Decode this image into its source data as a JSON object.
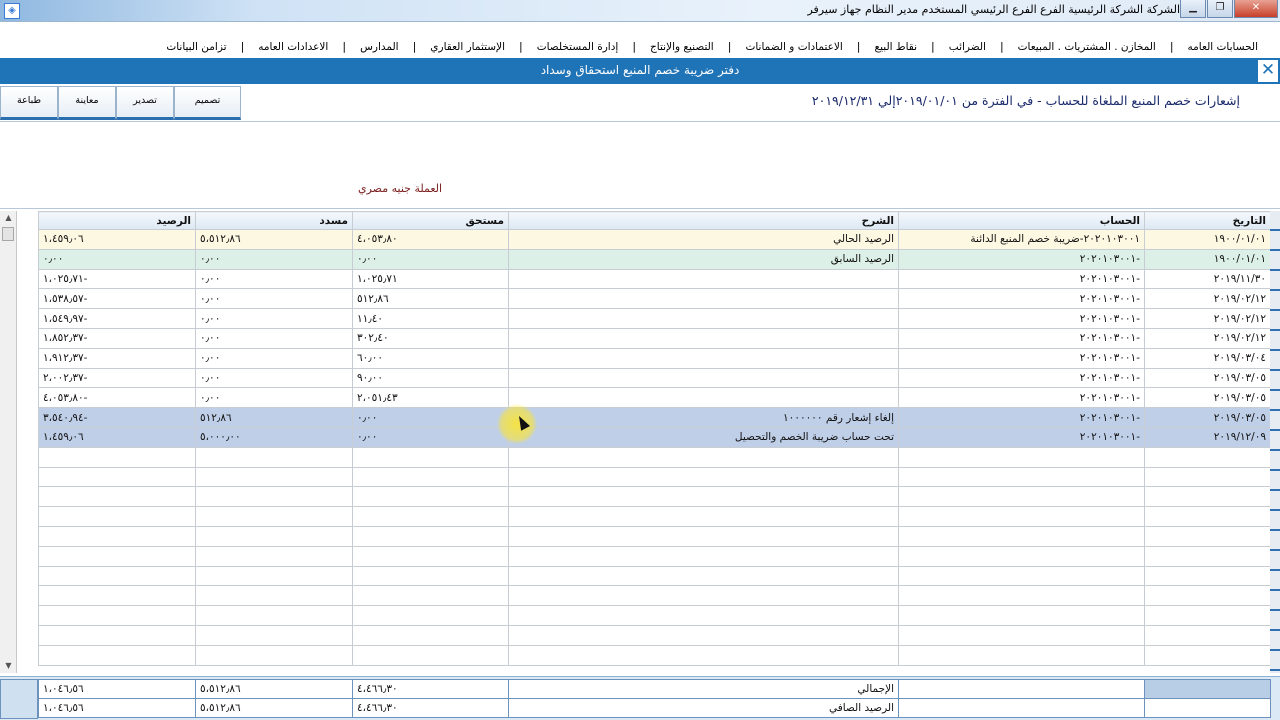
{
  "window": {
    "title": "الشركة الشركة الرئيسية    الفرع الفرع الرئيسي    المستخدم مدير النظام    جهاز سيرفر",
    "minimize": "▁",
    "restore": "❐",
    "close": "✕"
  },
  "menu": [
    "الحسابات العامه",
    "المخازن . المشتريات . المبيعات",
    "الضرائب",
    "نقاط البيع",
    "الاعتمادات و الضمانات",
    "التصنيع والإنتاج",
    "إدارة المستخلصات",
    "الإستثمار العقاري",
    "المدارس",
    "الاعدادات العامه",
    "تزامن البيانات"
  ],
  "banner": {
    "title": "دفتر ضريبة خصم المنبع استحقاق وسداد",
    "close": "✕"
  },
  "toolbar": {
    "design": "تصميم",
    "export": "تصدير",
    "preview": "معاينة",
    "print": "طباعة"
  },
  "report": {
    "heading": "إشعارات خصم المنبع الملغاة للحساب -     في الفترة من ٢٠١٩/٠١/٠١إلي ٢٠١٩/١٢/٣١",
    "currency": "العملة جنيه مصري"
  },
  "table": {
    "columns": {
      "date": "التاريخ",
      "account": "الحساب",
      "description": "الشرح",
      "due": "مستحق",
      "paid": "مسدد",
      "balance": "الرصيد"
    },
    "rows": [
      {
        "kind": "cur",
        "date": "١٩٠٠/٠١/٠١",
        "account": "٢٠٢٠١٠٣٠٠١-ضريبة خصم المنبع الدائنة",
        "description": "الرصيد الحالي",
        "due": "٤،٠٥٣٫٨٠",
        "paid": "٥،٥١٢٫٨٦",
        "balance": "١،٤٥٩٫٠٦"
      },
      {
        "kind": "prev",
        "date": "١٩٠٠/٠١/٠١",
        "account": "-٢٠٢٠١٠٣٠٠١",
        "description": "الرصيد السابق",
        "due": "٠٫٠٠",
        "paid": "٠٫٠٠",
        "balance": "٠٫٠٠"
      },
      {
        "kind": "",
        "date": "٢٠١٩/١١/٣٠",
        "account": "-٢٠٢٠١٠٣٠٠١",
        "description": "",
        "due": "١،٠٢٥٫٧١",
        "paid": "٠٫٠٠",
        "balance": "١،٠٢٥٫٧١-"
      },
      {
        "kind": "",
        "date": "٢٠١٩/٠٢/١٢",
        "account": "-٢٠٢٠١٠٣٠٠١",
        "description": "",
        "due": "٥١٢٫٨٦",
        "paid": "٠٫٠٠",
        "balance": "١،٥٣٨٫٥٧-"
      },
      {
        "kind": "",
        "date": "٢٠١٩/٠٢/١٢",
        "account": "-٢٠٢٠١٠٣٠٠١",
        "description": "",
        "due": "١١٫٤٠",
        "paid": "٠٫٠٠",
        "balance": "١،٥٤٩٫٩٧-"
      },
      {
        "kind": "",
        "date": "٢٠١٩/٠٢/١٢",
        "account": "-٢٠٢٠١٠٣٠٠١",
        "description": "",
        "due": "٣٠٢٫٤٠",
        "paid": "٠٫٠٠",
        "balance": "١،٨٥٢٫٣٧-"
      },
      {
        "kind": "",
        "date": "٢٠١٩/٠٣/٠٤",
        "account": "-٢٠٢٠١٠٣٠٠١",
        "description": "",
        "due": "٦٠٫٠٠",
        "paid": "٠٫٠٠",
        "balance": "١،٩١٢٫٣٧-"
      },
      {
        "kind": "",
        "date": "٢٠١٩/٠٣/٠٥",
        "account": "-٢٠٢٠١٠٣٠٠١",
        "description": "",
        "due": "٩٠٫٠٠",
        "paid": "٠٫٠٠",
        "balance": "٢،٠٠٢٫٣٧-"
      },
      {
        "kind": "",
        "date": "٢٠١٩/٠٣/٠٥",
        "account": "-٢٠٢٠١٠٣٠٠١",
        "description": "",
        "due": "٢،٠٥١٫٤٣",
        "paid": "٠٫٠٠",
        "balance": "٤،٠٥٣٫٨٠-"
      },
      {
        "kind": "sel",
        "date": "٢٠١٩/٠٣/٠٥",
        "account": "-٢٠٢٠١٠٣٠٠١",
        "description": "إلغاء إشعار رقم ١٠٠٠٠٠٠",
        "due": "٠٫٠٠",
        "paid": "٥١٢٫٨٦",
        "balance": "٣،٥٤٠٫٩٤-"
      },
      {
        "kind": "sel",
        "date": "٢٠١٩/١٢/٠٩",
        "account": "-٢٠٢٠١٠٣٠٠١",
        "description": "تحت حساب ضريبة الخصم والتحصيل",
        "due": "٠٫٠٠",
        "paid": "٥،٠٠٠٫٠٠",
        "balance": "١،٤٥٩٫٠٦"
      }
    ],
    "empty_rows": 11
  },
  "totals": {
    "total_label": "الإجمالي",
    "net_label": "الرصيد الصافي",
    "due": "٤،٤٦٦٫٣٠",
    "paid": "٥،٥١٢٫٨٦",
    "balance": "١،٠٤٦٫٥٦"
  },
  "colors": {
    "banner": "#1f73b7",
    "selected_row": "#bfcfe8",
    "current_row": "#fdf8e2",
    "previous_row": "#ddf0e8"
  }
}
